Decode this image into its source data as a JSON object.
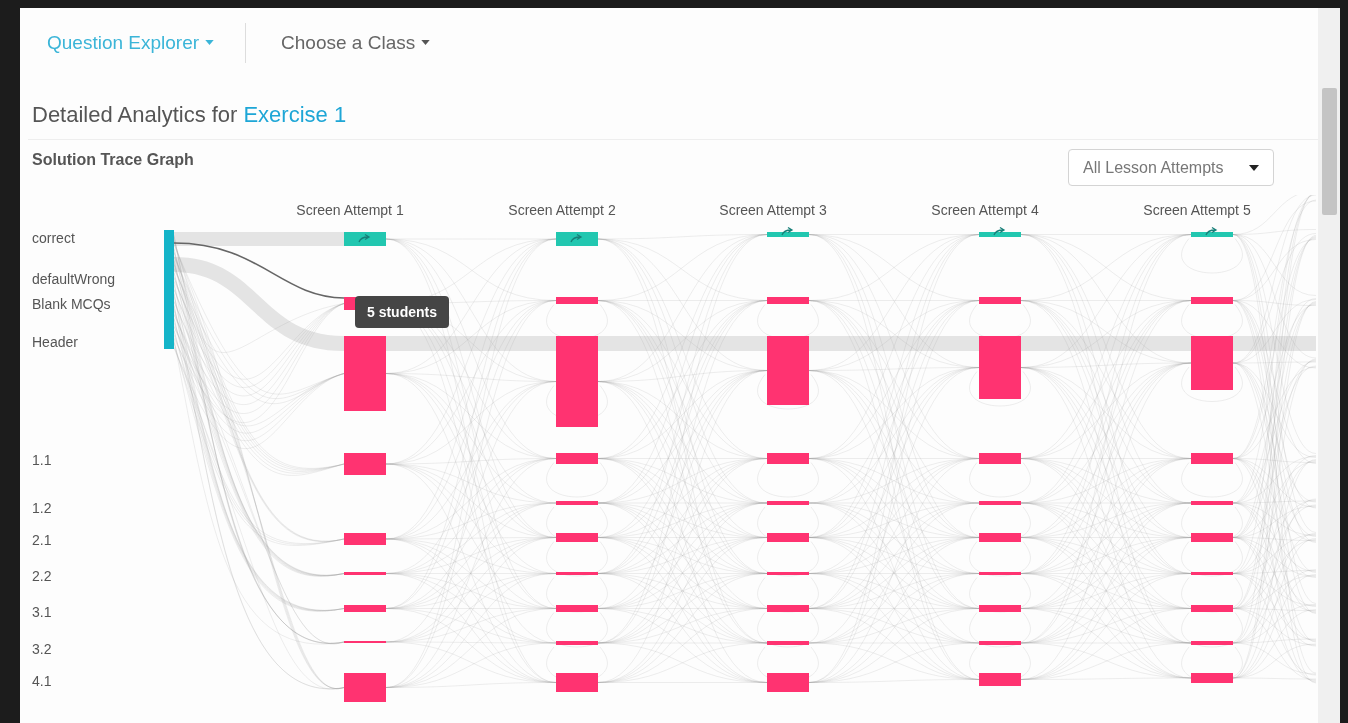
{
  "nav": {
    "items": [
      {
        "label": "Question Explorer",
        "selected": true
      },
      {
        "label": "Choose a Class",
        "selected": false
      }
    ]
  },
  "heading": {
    "prefix": "Detailed Analytics for",
    "exercise": "Exercise 1"
  },
  "section_title": "Solution Trace Graph",
  "attempt_filter": {
    "value": "All Lesson Attempts"
  },
  "graph": {
    "columns": [
      "Screen Attempt 1",
      "Screen Attempt 2",
      "Screen Attempt 3",
      "Screen Attempt 4",
      "Screen Attempt 5"
    ],
    "rows": [
      {
        "label": "correct",
        "kind": "correct"
      },
      {
        "label": "defaultWrong",
        "kind": "wrong"
      },
      {
        "label": "Blank MCQs",
        "kind": "wrong"
      },
      {
        "label": "Header",
        "kind": "wrong"
      },
      {
        "label": "1.1",
        "kind": "wrong"
      },
      {
        "label": "1.2",
        "kind": "wrong"
      },
      {
        "label": "2.1",
        "kind": "wrong"
      },
      {
        "label": "2.2",
        "kind": "wrong"
      },
      {
        "label": "3.1",
        "kind": "wrong"
      },
      {
        "label": "3.2",
        "kind": "wrong"
      },
      {
        "label": "4.1",
        "kind": "wrong"
      }
    ],
    "tooltip": "5 students"
  }
}
